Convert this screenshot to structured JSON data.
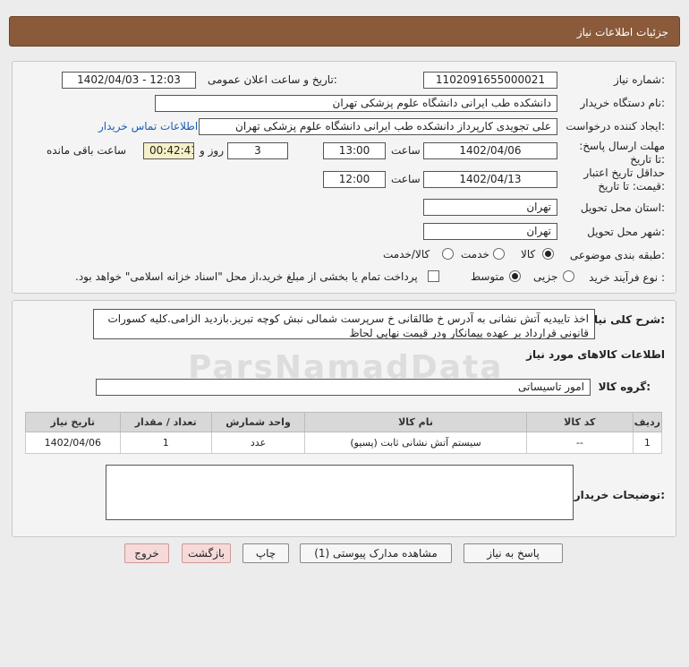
{
  "header": {
    "title": "جزئیات اطلاعات نیاز"
  },
  "fields": {
    "need_number_label": "شماره نیاز:",
    "need_number": "1102091655000021",
    "announce_label": "تاریخ و ساعت اعلان عمومی:",
    "announce_value": "1402/04/03 - 12:03",
    "buyer_label": "نام دستگاه خریدار:",
    "buyer_value": "دانشکده طب ایرانی دانشگاه علوم پزشکی تهران",
    "requester_label": "ایجاد کننده درخواست:",
    "requester_value": "علی تجویدی کارپرداز دانشکده طب ایرانی دانشگاه علوم پزشکی تهران",
    "contact_link": "اطلاعات تماس خریدار",
    "deadline_label": "مهلت ارسال پاسخ: تا تاریخ:",
    "deadline_date": "1402/04/06",
    "time_label": "ساعت",
    "deadline_time": "13:00",
    "days_value": "3",
    "days_label": "روز و",
    "remaining_value": "00:42:41",
    "remaining_label": "ساعت باقی مانده",
    "validity_label": "حداقل تاریخ اعتبار قیمت: تا تاریخ:",
    "validity_date": "1402/04/13",
    "validity_time": "12:00",
    "province_label": "استان محل تحویل:",
    "province_value": "تهران",
    "city_label": "شهر محل تحویل:",
    "city_value": "تهران",
    "category_label": "طبقه بندی موضوعی:",
    "category_options": [
      "کالا",
      "خدمت",
      "کالا/خدمت"
    ],
    "process_label": "نوع فرآیند خرید :",
    "process_options": [
      "جزیی",
      "متوسط"
    ],
    "payment_note": "پرداخت تمام یا بخشی از مبلغ خرید،از محل \"اسناد خزانه اسلامی\" خواهد بود."
  },
  "description": {
    "label": "شرح کلی نیاز:",
    "text": "اخذ تاییدیه آتش نشانی به آدرس خ طالقانی خ سرپرست شمالی نبش کوچه تبریز.بازدید  الزامی.کلیه کسورات قانونی قرارداد بر عهده پیمانکار ودر قیمت نهایی لحاظ"
  },
  "goods": {
    "section_title": "اطلاعات کالاهای مورد نیاز",
    "group_label": "گروه کالا:",
    "group_value": "امور تاسیساتی",
    "columns": [
      "ردیف",
      "کد کالا",
      "نام کالا",
      "واحد شمارش",
      "تعداد / مقدار",
      "تاریخ نیاز"
    ],
    "rows": [
      [
        "1",
        "--",
        "سیستم آتش نشانی ثابت (پسیو)",
        "عدد",
        "1",
        "1402/04/06"
      ]
    ],
    "buyer_notes_label": "توضیحات خریدار:"
  },
  "buttons": {
    "reply": "پاسخ به نیاز",
    "attachments": "مشاهده مدارک پیوستی (1)",
    "print": "چاپ",
    "back": "بازگشت",
    "exit": "خروج"
  },
  "watermark": "ParsNamadData"
}
